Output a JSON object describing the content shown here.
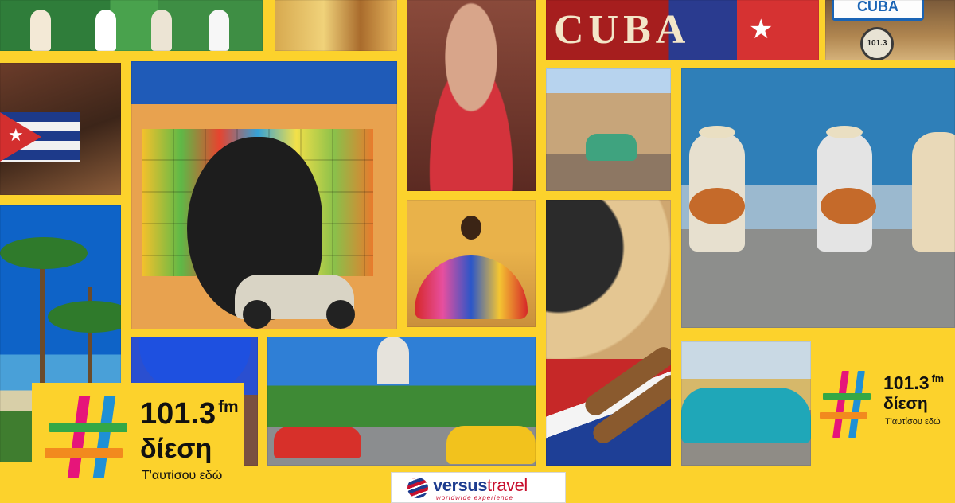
{
  "background_color": "#fcd22c",
  "photos": [
    {
      "subject": "dancers-street"
    },
    {
      "subject": "colonial-street"
    },
    {
      "subject": "woman-cigar"
    },
    {
      "subject": "cuba-sign-flag"
    },
    {
      "subject": "cuba-plate-gauge"
    },
    {
      "subject": "flag-cigars"
    },
    {
      "subject": "che-mural-scooter"
    },
    {
      "subject": "woman-colorful-dress"
    },
    {
      "subject": "vintage-car-street"
    },
    {
      "subject": "street-musicians"
    },
    {
      "subject": "palm-beach"
    },
    {
      "subject": "woman-blue-headwrap"
    },
    {
      "subject": "capitol-classic-cars"
    },
    {
      "subject": "hat-cigars-flag"
    },
    {
      "subject": "turquoise-classic-car"
    }
  ],
  "cuba_sign_text": "CUBA",
  "plate_text": "CUBA",
  "gauge_text": "101.3",
  "radio_logo": {
    "frequency": "101.3",
    "unit": "fm",
    "name": "δίεση",
    "slogan": "Τ'αυτίσου εδώ",
    "colors": {
      "pink": "#e6157a",
      "green": "#34a846",
      "blue": "#1f90d5",
      "orange": "#f28a1e"
    },
    "icon": "hash-icon"
  },
  "sponsor": {
    "name_part1": "versus",
    "name_part2": "travel",
    "tagline": "worldwide experience",
    "icon": "globe-icon"
  }
}
